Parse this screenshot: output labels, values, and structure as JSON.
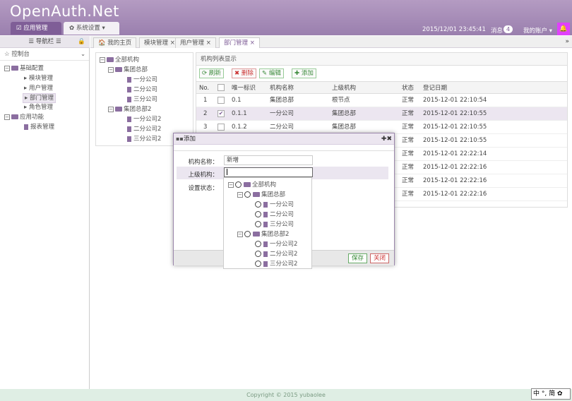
{
  "app": {
    "logo": "OpenAuth.Net"
  },
  "topbar": {
    "menu_app": "☑ 应用管理",
    "menu_sys": "✿ 系统设置 ▾",
    "datetime": "2015/12/01 23:45:41",
    "msg_label": "消息",
    "msg_count": "4",
    "account": "我的账户 ▾",
    "bell": "🔔"
  },
  "navbar": {
    "label": "☰ 导航栏 ☰",
    "lock": "🔒"
  },
  "sidebar": {
    "console": "☆ 控制台",
    "console_arrow": "⌄",
    "base_group": "基础配置",
    "items": [
      "模块管理",
      "用户管理",
      "部门管理",
      "角色管理"
    ],
    "app_group": "应用功能",
    "app_items": [
      "报表管理"
    ]
  },
  "tabs": [
    {
      "label": "🏠 我的主页"
    },
    {
      "label": "模块管理 ×"
    },
    {
      "label": "用户管理 ×"
    },
    {
      "label": "部门管理 ×"
    }
  ],
  "tabs_overflow": "»",
  "org_tree": {
    "root": "全部机构",
    "groups": [
      {
        "label": "集团总部",
        "children": [
          "一分公司",
          "二分公司",
          "三分公司"
        ]
      },
      {
        "label": "集团总部2",
        "children": [
          "一分公司2",
          "二分公司2",
          "三分公司2"
        ]
      }
    ]
  },
  "list": {
    "title": "机构列表显示",
    "buttons": {
      "refresh": "⟳ 刷新",
      "delete": "✖ 删除",
      "edit": "✎ 编辑",
      "add": "✚ 添加"
    },
    "headers": [
      "No.",
      "",
      "唯一标识",
      "机构名称",
      "上级机构",
      "状态",
      "登记日期"
    ],
    "rows": [
      {
        "no": "1",
        "checked": false,
        "id": "0.1",
        "name": "集团总部",
        "parent": "根节点",
        "status": "正常",
        "date": "2015-12-01 22:10:54"
      },
      {
        "no": "2",
        "checked": true,
        "id": "0.1.1",
        "name": "一分公司",
        "parent": "集团总部",
        "status": "正常",
        "date": "2015-12-01 22:10:55"
      },
      {
        "no": "3",
        "checked": false,
        "id": "0.1.2",
        "name": "二分公司",
        "parent": "集团总部",
        "status": "正常",
        "date": "2015-12-01 22:10:55"
      },
      {
        "no": "",
        "checked": false,
        "id": "",
        "name": "",
        "parent": "",
        "status": "正常",
        "date": "2015-12-01 22:10:55"
      },
      {
        "no": "",
        "checked": false,
        "id": "",
        "name": "",
        "parent": "",
        "status": "正常",
        "date": "2015-12-01 22:22:14"
      },
      {
        "no": "",
        "checked": false,
        "id": "",
        "name": "",
        "parent": "",
        "status": "正常",
        "date": "2015-12-01 22:22:16"
      },
      {
        "no": "",
        "checked": false,
        "id": "",
        "name": "",
        "parent": "",
        "status": "正常",
        "date": "2015-12-01 22:22:16"
      },
      {
        "no": "",
        "checked": false,
        "id": "",
        "name": "",
        "parent": "",
        "status": "正常",
        "date": "2015-12-01 22:22:16"
      }
    ]
  },
  "dialog": {
    "title": "添加",
    "head_icons": "✚✖",
    "name_label": "机构名称：",
    "name_value": "新增",
    "parent_label": "上级机构：",
    "parent_value": "",
    "status_label": "设置状态：",
    "save": "保存",
    "close": "关闭"
  },
  "dropdown_tree": {
    "root": "全部机构",
    "groups": [
      {
        "label": "集团总部",
        "children": [
          "一分公司",
          "二分公司",
          "三分公司"
        ]
      },
      {
        "label": "集团总部2",
        "children": [
          "一分公司2",
          "二分公司2",
          "三分公司2"
        ]
      }
    ]
  },
  "footer": {
    "copyright": "Copyright © 2015  yubaolee"
  },
  "ime": {
    "text": "中 °, 简 ✿"
  }
}
